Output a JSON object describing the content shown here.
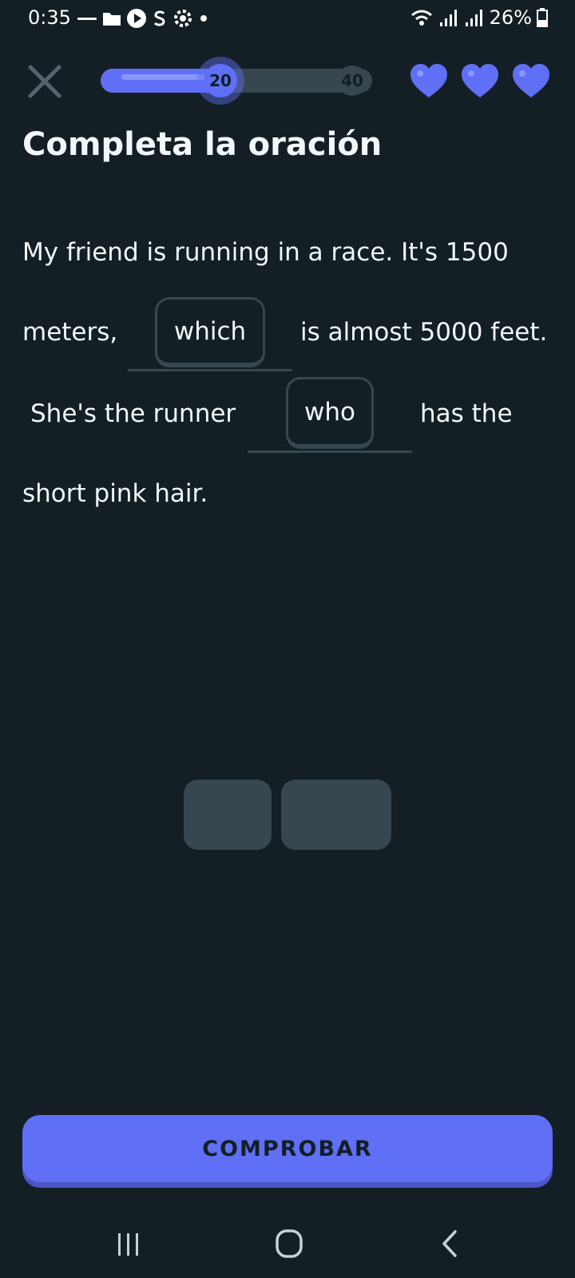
{
  "status_bar": {
    "time": "0:35",
    "battery": "26%",
    "left_icons": [
      "notification-icon",
      "folder-icon",
      "play-icon",
      "s-icon",
      "settings-icon",
      "dot-icon"
    ],
    "right_icons": [
      "wifi-icon",
      "signal-icon",
      "signal-icon",
      "battery-icon"
    ]
  },
  "top_bar": {
    "progress_current": "20",
    "progress_total": "40",
    "progress_fraction": 0.5,
    "hearts_count": 3
  },
  "title": "Completa la oración",
  "sentence": {
    "line1": "My friend is running in a race. It's 1500",
    "line2_before": "meters,",
    "blank1_word": "which",
    "line2_after": "is almost 5000 feet.",
    "line3_before": "She's the runner",
    "blank2_word": "who",
    "line3_after": "has the",
    "line4": "short pink hair."
  },
  "check_button": "COMPROBAR",
  "colors": {
    "background": "#131f24",
    "accent": "#5f6ff6",
    "muted": "#37464f",
    "text": "#f1f7fb"
  }
}
